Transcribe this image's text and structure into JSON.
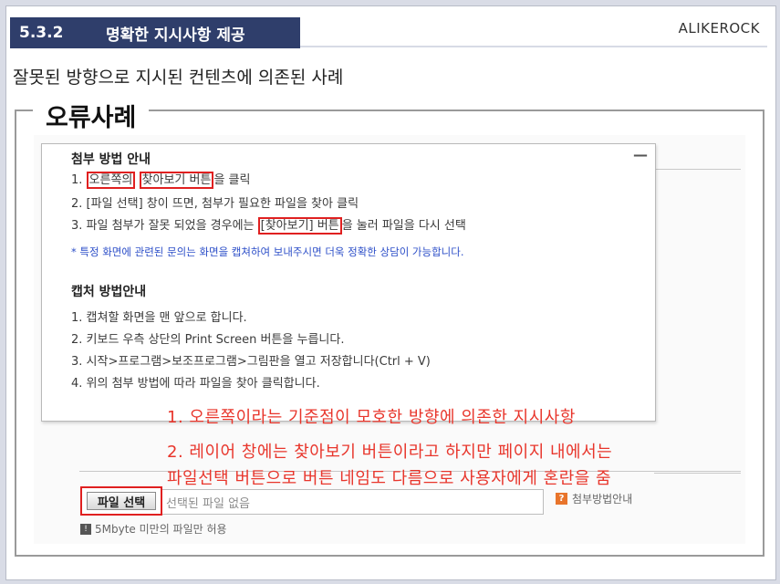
{
  "header": {
    "section_number": "5.3.2",
    "section_title": "명확한 지시사항 제공",
    "brand": "ALIKEROCK"
  },
  "subtitle": "잘못된 방향으로 지시된 컨텐츠에 의존된 사례",
  "group_title": "오류사례",
  "popup": {
    "attach_heading": "첨부 방법 안내",
    "attach_steps": {
      "s1_prefix": "1. ",
      "s1_a": "오른쪽의",
      "s1_b": "찾아보기 버튼",
      "s1_suffix": "을 클릭",
      "s2": "2. [파일 선택] 창이 뜨면, 첨부가 필요한 파일을 찾아 클릭",
      "s3_prefix": "3. 파일 첨부가 잘못 되었을 경우에는 ",
      "s3_box": "[찾아보기] 버튼",
      "s3_suffix": "을 눌러 파일을 다시 선택"
    },
    "note": "* 특정 화면에 관련된 문의는 화면을 캡쳐하여 보내주시면 더욱 정확한 상담이 가능합니다.",
    "capture_heading": "캡처 방법안내",
    "capture_steps": [
      "1. 캡쳐할 화면을 맨 앞으로 합니다.",
      "2. 키보드 우측 상단의 Print Screen 버튼을 누릅니다.",
      "3. 시작>프로그램>보조프로그램>그림판을 열고 저장합니다(Ctrl + V)",
      "4. 위의 첨부 방법에 따라 파일을 찾아 클릭합니다."
    ]
  },
  "annotations": [
    "1. 오른쪽이라는 기준점이 모호한 방향에 의존한 지시사항",
    "2. 레이어 창에는 찾아보기 버튼이라고 하지만 페이지 내에서는",
    "파일선택 버튼으로 버튼 네임도 다름으로 사용자에게 혼란을 줌"
  ],
  "file_field": {
    "button_label": "파일 선택",
    "placeholder": "선택된 파일 없음",
    "help_label": "첨부방법안내",
    "help_icon": "?",
    "limit_icon": "!",
    "limit_text": "5Mbyte 미만의 파일만 허용"
  },
  "colors": {
    "badge": "#2f3e6b",
    "annotation": "#e8352b",
    "highlight_box": "#e02020",
    "note": "#2d4fc8"
  }
}
